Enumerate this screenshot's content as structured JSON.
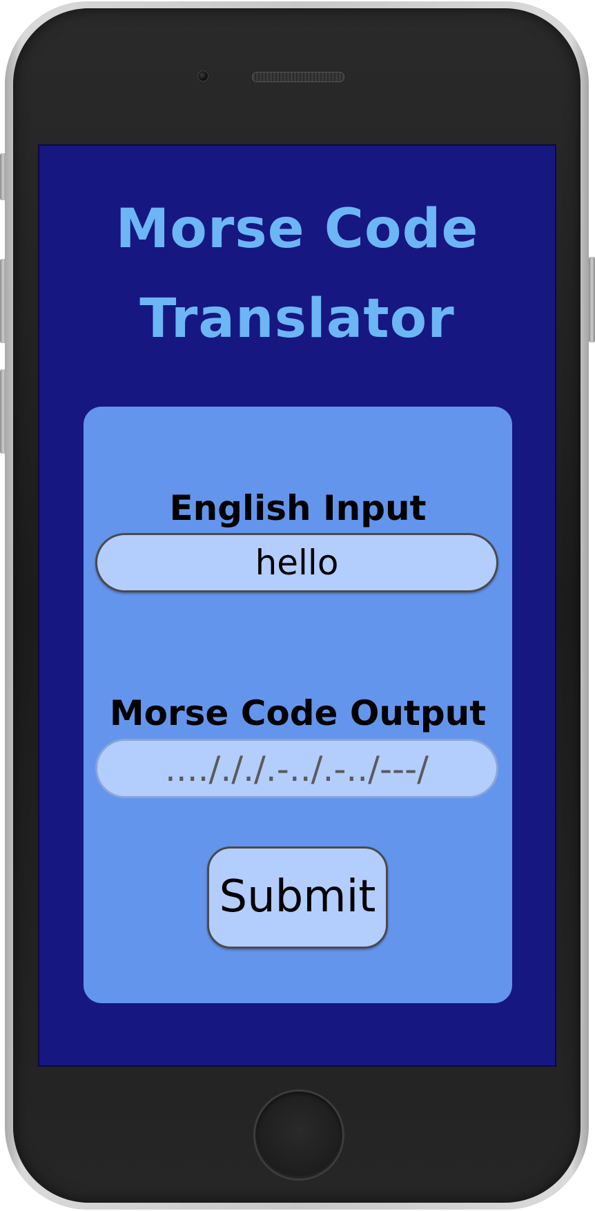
{
  "app": {
    "title_line1": "Morse Code",
    "title_line2": "Translator"
  },
  "form": {
    "input_label": "English Input",
    "input_value": "hello",
    "output_label": "Morse Code Output",
    "output_value": "..../././.-../.-../---/",
    "submit_label": "Submit"
  },
  "colors": {
    "screen_background": "#171782",
    "panel_background": "#6495ed",
    "title_color": "#6cb6f5",
    "field_background": "#b3cdfc"
  }
}
